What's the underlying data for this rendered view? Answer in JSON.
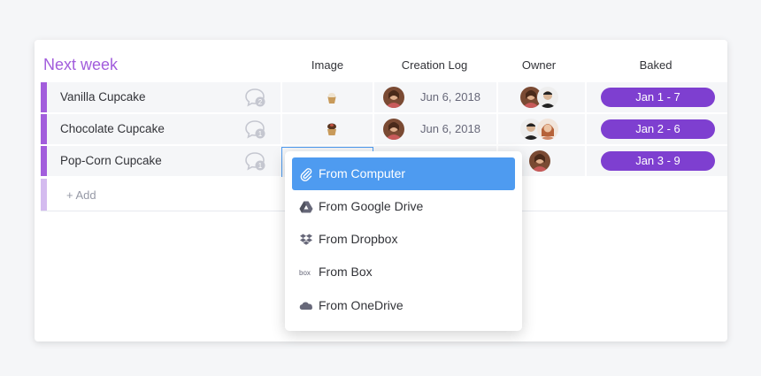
{
  "group": {
    "title": "Next week",
    "color": "#a25ddc"
  },
  "columns": {
    "image": "Image",
    "creation_log": "Creation Log",
    "owner": "Owner",
    "baked": "Baked"
  },
  "rows": [
    {
      "name": "Vanilla Cupcake",
      "updates": "2",
      "date": "Jun 6, 2018",
      "baked": "Jan 1 - 7",
      "thumb": "vanilla-cupcake-thumbnail"
    },
    {
      "name": "Chocolate Cupcake",
      "updates": "1",
      "date": "Jun 6, 2018",
      "baked": "Jan 2 - 6",
      "thumb": "chocolate-cupcake-thumbnail"
    },
    {
      "name": "Pop-Corn Cupcake",
      "updates": "1",
      "date": "",
      "baked": "Jan 3 - 9",
      "thumb": ""
    }
  ],
  "add_row": {
    "label": "+ Add"
  },
  "dropdown": {
    "items": [
      {
        "label": "From Computer",
        "icon": "paperclip-icon",
        "active": true
      },
      {
        "label": "From Google Drive",
        "icon": "google-drive-icon",
        "active": false
      },
      {
        "label": "From Dropbox",
        "icon": "dropbox-icon",
        "active": false
      },
      {
        "label": "From Box",
        "icon": "box-icon",
        "active": false
      },
      {
        "label": "From OneDrive",
        "icon": "onedrive-icon",
        "active": false
      }
    ]
  },
  "colors": {
    "accent_purple": "#a25ddc",
    "pill_purple": "#7e3fd0",
    "selected_blue": "#4e9bf0"
  }
}
